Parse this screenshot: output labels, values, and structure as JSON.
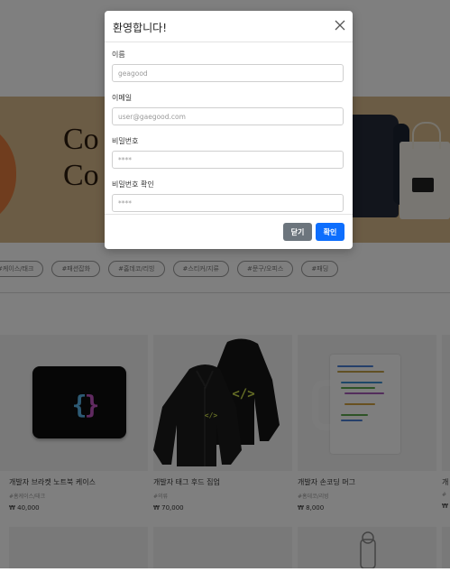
{
  "banner": {
    "title_line1": "Co",
    "title_line2": "Co"
  },
  "tags": [
    "#케이스/태크",
    "#패션잡화",
    "#홈데코/리빙",
    "#스티커/지류",
    "#문구/오피스",
    "#패딩"
  ],
  "products": [
    {
      "name": "개발자 브라켓 노트북 케이스",
      "tag": "#홈케이스/태크",
      "price": "₩ 40,000",
      "icon": "laptop-case-icon"
    },
    {
      "name": "개발자 태그 후드 집업",
      "tag": "#의류",
      "price": "₩ 70,000",
      "icon": "hoodie-icon"
    },
    {
      "name": "개발자 손코딩 머그",
      "tag": "#홈데코/리빙",
      "price": "₩ 8,000",
      "icon": "mug-icon"
    }
  ],
  "edge_products": [
    {
      "name": "개",
      "tag": "#",
      "price": "₩"
    }
  ],
  "modal": {
    "title": "환영합니다!",
    "close_icon": "close-icon",
    "fields": [
      {
        "label": "이름",
        "placeholder": "geagood"
      },
      {
        "label": "이메일",
        "placeholder": "user@gaegood.com"
      },
      {
        "label": "비밀번호",
        "placeholder": "****"
      },
      {
        "label": "비밀번호 확인",
        "placeholder": "****"
      }
    ],
    "close_label": "닫기",
    "confirm_label": "확인"
  },
  "colors": {
    "overlay": "rgba(0,0,0,0.5)",
    "primary": "#0d6efd",
    "secondary": "#6c757d",
    "banner": "#d6b88b"
  }
}
